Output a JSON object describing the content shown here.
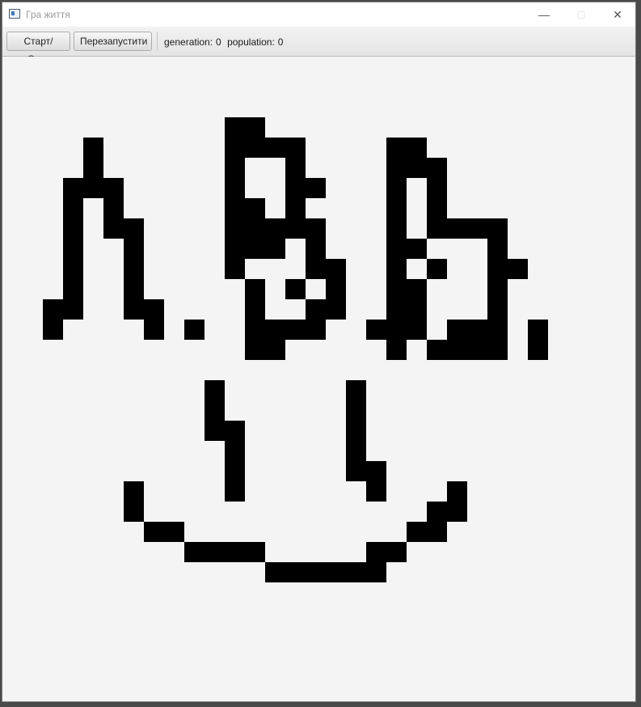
{
  "window": {
    "title": "Гра життя"
  },
  "toolbar": {
    "start_stop_label": "Старт/Стоп",
    "restart_label": "Перезапустити",
    "generation_label": "generation:",
    "generation_value": "0",
    "population_label": "population:",
    "population_value": "0"
  },
  "board": {
    "cell_color": "#000000",
    "background_color": "#f4f4f4",
    "rows": [
      "..........................................",
      "..........................................",
      "..........................................",
      "...........##.............................",
      "....#......####....##.....................",
      "....#......#..#....###....................",
      "...###.....#..##...#.#....................",
      "...#.#.....##.#....#.#....................",
      "...#.##....#####...#.####.................",
      "...#..#....###.#...##...#.................",
      "...#..#....#...##..#.#..##................",
      "...#..#.....#.#.#..##...#.................",
      "..##..##....#..##..##...#.................",
      "..#....#.#..####..###.###.#...............",
      "............##.....#.####.#...............",
      "..........................................",
      "..........#......#........................",
      "..........#......#........................",
      "..........##.....#........................",
      "...........#.....#........................",
      "...........#.....##.......................",
      "......#....#......#...#...................",
      "......#..............##...................",
      ".......##...........##....................",
      ".........####.....##......................",
      ".............######......................."
    ]
  }
}
